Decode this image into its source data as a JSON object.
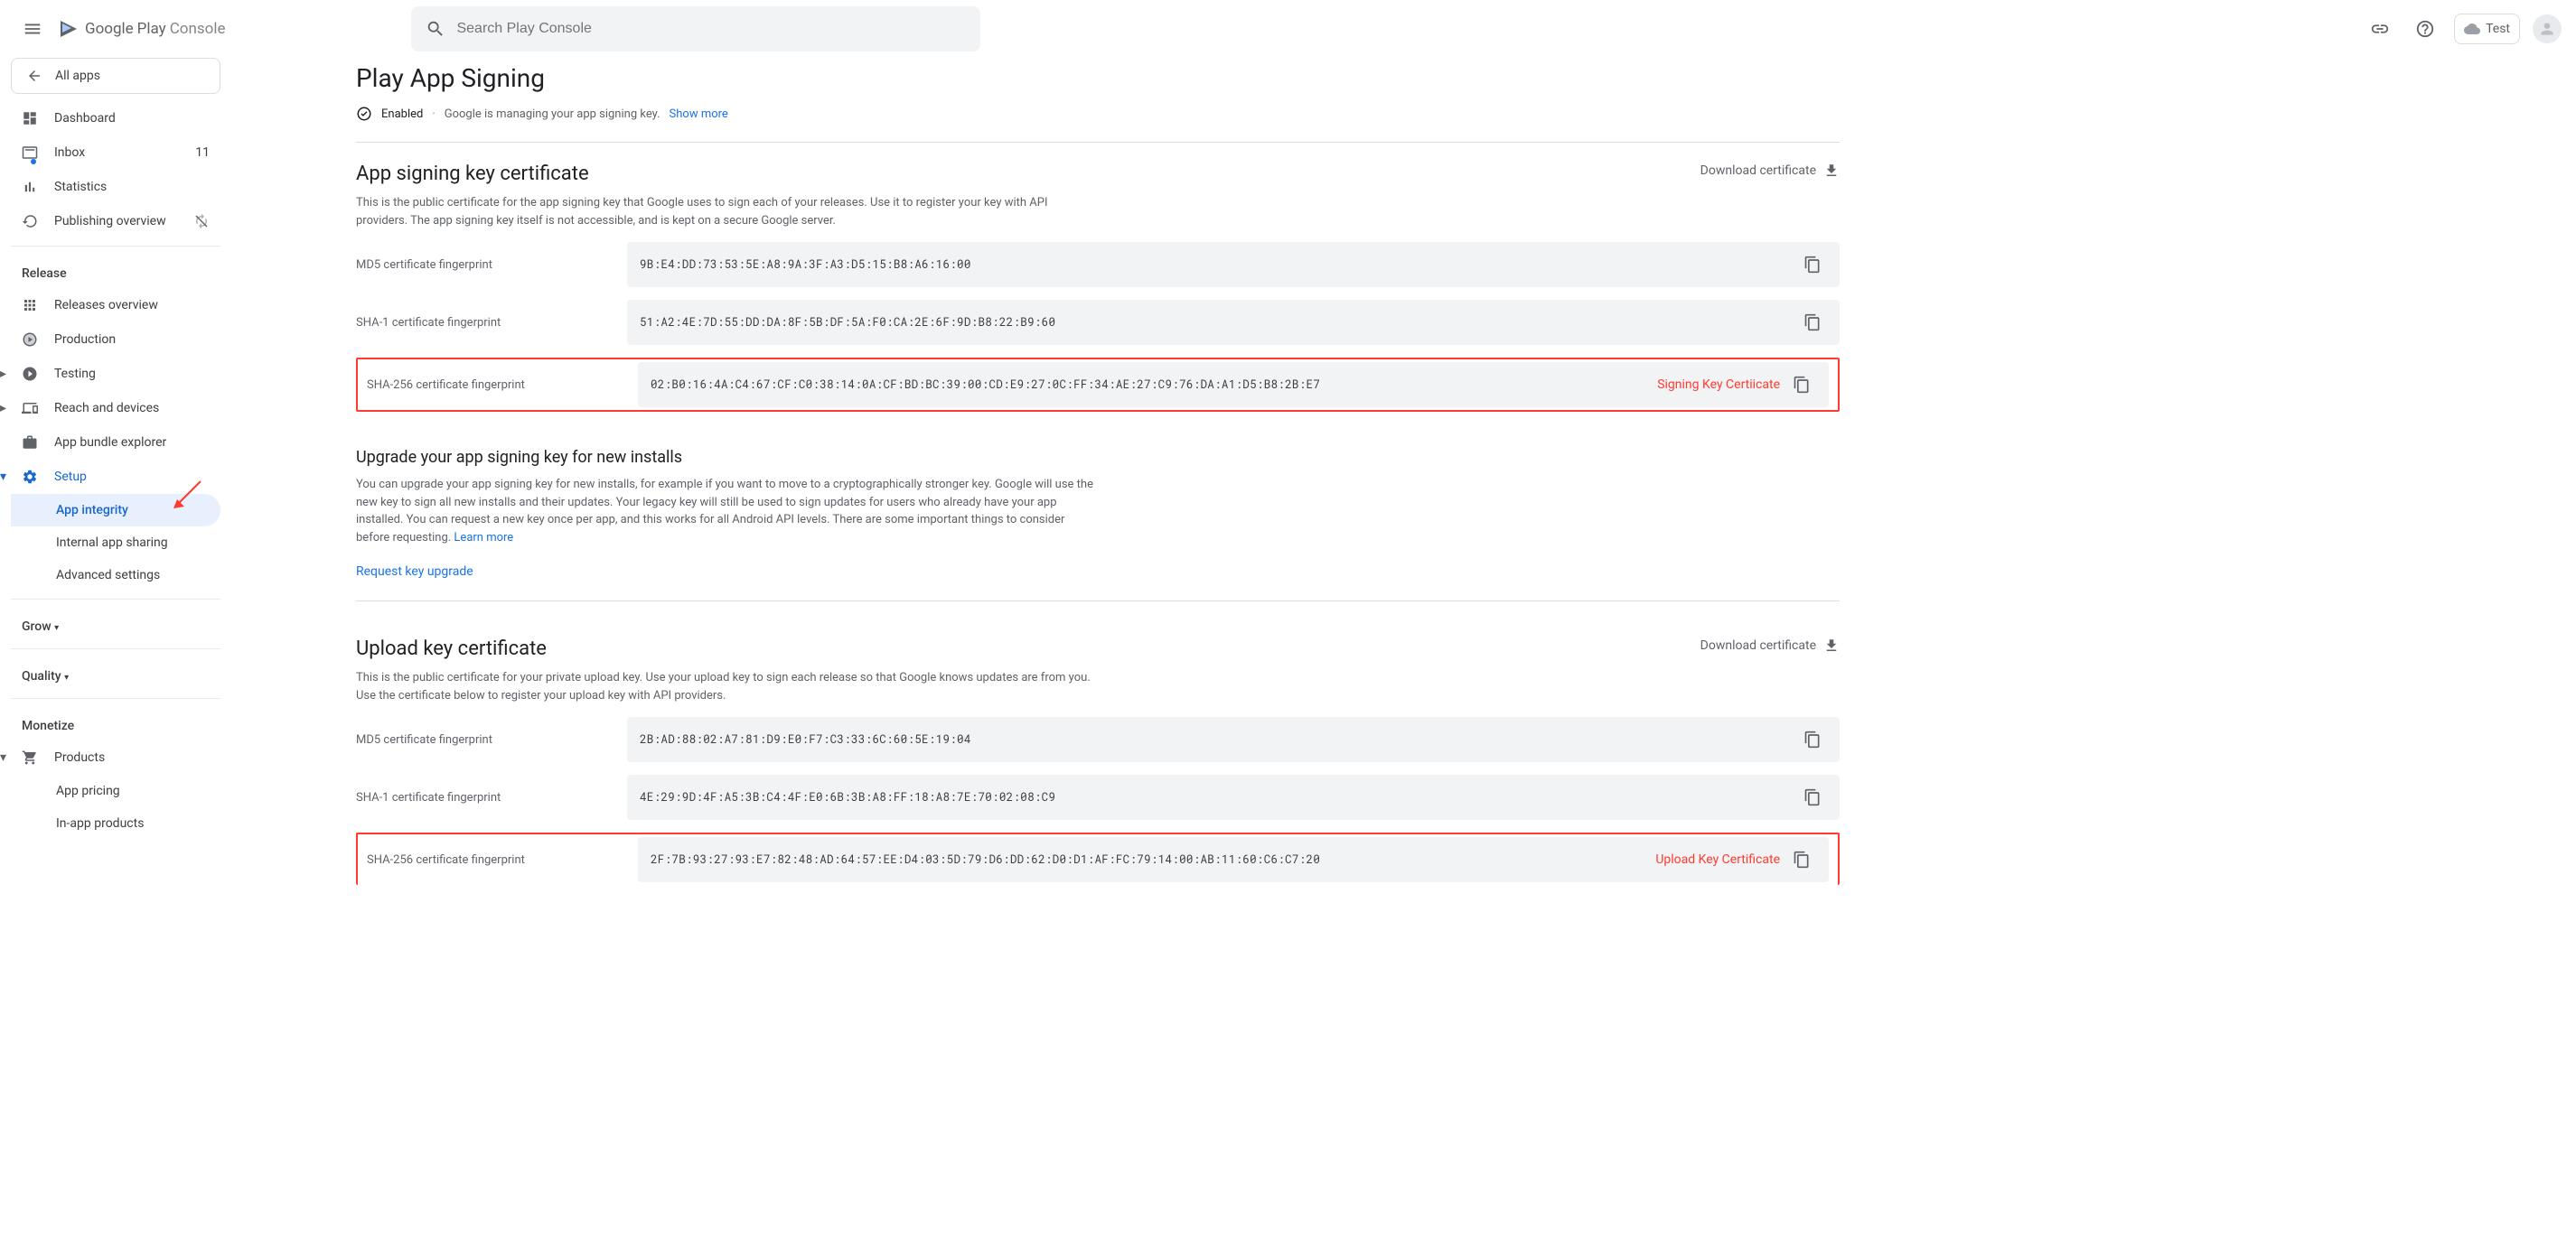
{
  "header": {
    "logo_google": "Google",
    "logo_play": "Play",
    "logo_console": "Console",
    "search_placeholder": "Search Play Console",
    "app_name": "Test"
  },
  "sidebar": {
    "all_apps": "All apps",
    "dashboard": "Dashboard",
    "inbox": "Inbox",
    "inbox_count": "11",
    "statistics": "Statistics",
    "publishing_overview": "Publishing overview",
    "release_header": "Release",
    "releases_overview": "Releases overview",
    "production": "Production",
    "testing": "Testing",
    "reach_devices": "Reach and devices",
    "app_bundle": "App bundle explorer",
    "setup": "Setup",
    "app_integrity": "App integrity",
    "internal_sharing": "Internal app sharing",
    "advanced_settings": "Advanced settings",
    "grow": "Grow",
    "quality": "Quality",
    "monetize": "Monetize",
    "products": "Products",
    "app_pricing": "App pricing",
    "in_app_products": "In-app products"
  },
  "page": {
    "title": "Play App Signing",
    "status_enabled": "Enabled",
    "status_desc": "Google is managing your app signing key.",
    "show_more": "Show more",
    "download_cert": "Download certificate"
  },
  "signing": {
    "title": "App signing key certificate",
    "desc": "This is the public certificate for the app signing key that Google uses to sign each of your releases. Use it to register your key with API providers. The app signing key itself is not accessible, and is kept on a secure Google server.",
    "md5_label": "MD5 certificate fingerprint",
    "md5_value": "9B:E4:DD:73:53:5E:A8:9A:3F:A3:D5:15:B8:A6:16:00",
    "sha1_label": "SHA-1 certificate fingerprint",
    "sha1_value": "51:A2:4E:7D:55:DD:DA:8F:5B:DF:5A:F0:CA:2E:6F:9D:B8:22:B9:60",
    "sha256_label": "SHA-256 certificate fingerprint",
    "sha256_value": "02:B0:16:4A:C4:67:CF:C0:38:14:0A:CF:BD:BC:39:00:CD:E9:27:0C:FF:34:AE:27:C9:76:DA:A1:D5:B8:2B:E7",
    "annotation": "Signing Key Certiicate"
  },
  "upgrade": {
    "title": "Upgrade your app signing key for new installs",
    "desc": "You can upgrade your app signing key for new installs, for example if you want to move to a cryptographically stronger key. Google will use the new key to sign all new installs and their updates. Your legacy key will still be used to sign updates for users who already have your app installed. You can request a new key once per app, and this works for all Android API levels. There are some important things to consider before requesting.",
    "learn_more": "Learn more",
    "request": "Request key upgrade"
  },
  "upload": {
    "title": "Upload key certificate",
    "desc": "This is the public certificate for your private upload key. Use your upload key to sign each release so that Google knows updates are from you. Use the certificate below to register your upload key with API providers.",
    "md5_label": "MD5 certificate fingerprint",
    "md5_value": "2B:AD:88:02:A7:81:D9:E0:F7:C3:33:6C:60:5E:19:04",
    "sha1_label": "SHA-1 certificate fingerprint",
    "sha1_value": "4E:29:9D:4F:A5:3B:C4:4F:E0:6B:3B:A8:FF:18:A8:7E:70:02:08:C9",
    "sha256_label": "SHA-256 certificate fingerprint",
    "sha256_value": "2F:7B:93:27:93:E7:82:48:AD:64:57:EE:D4:03:5D:79:D6:DD:62:D0:D1:AF:FC:79:14:00:AB:11:60:C6:C7:20",
    "annotation": "Upload Key Certificate"
  }
}
